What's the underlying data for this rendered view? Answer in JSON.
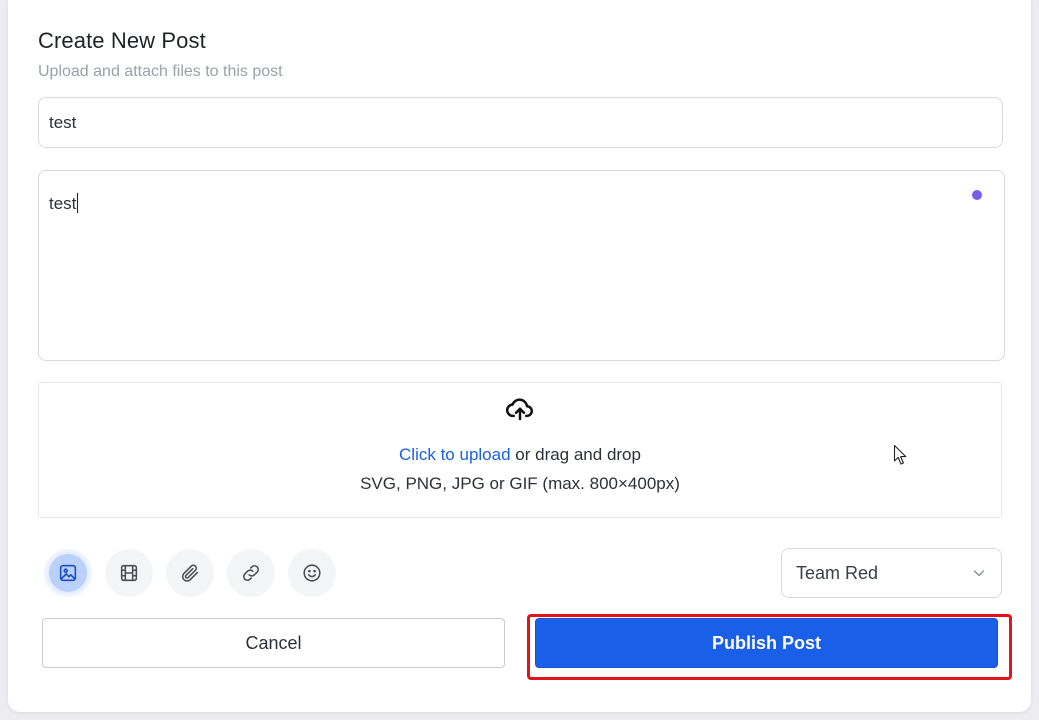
{
  "dialog": {
    "title": "Create New Post",
    "subtitle": "Upload and attach files to this post"
  },
  "form": {
    "title_value": "test",
    "body_value": "test"
  },
  "upload": {
    "link_text": "Click to upload",
    "drag_text": " or drag and drop",
    "formats_text": "SVG, PNG, JPG or GIF (max. 800×400px)",
    "icon": "cloud-upload-icon"
  },
  "toolbar": {
    "tools": [
      {
        "icon": "image-icon",
        "active": true
      },
      {
        "icon": "film-icon",
        "active": false
      },
      {
        "icon": "paperclip-icon",
        "active": false
      },
      {
        "icon": "link-icon",
        "active": false
      },
      {
        "icon": "emoji-icon",
        "active": false
      }
    ]
  },
  "team_select": {
    "value": "Team Red"
  },
  "actions": {
    "cancel_label": "Cancel",
    "publish_label": "Publish Post"
  },
  "colors": {
    "accent": "#1a5fe8",
    "link": "#1a5fe0",
    "highlight": "#e0151b",
    "status_dot": "#7b5cf0"
  }
}
